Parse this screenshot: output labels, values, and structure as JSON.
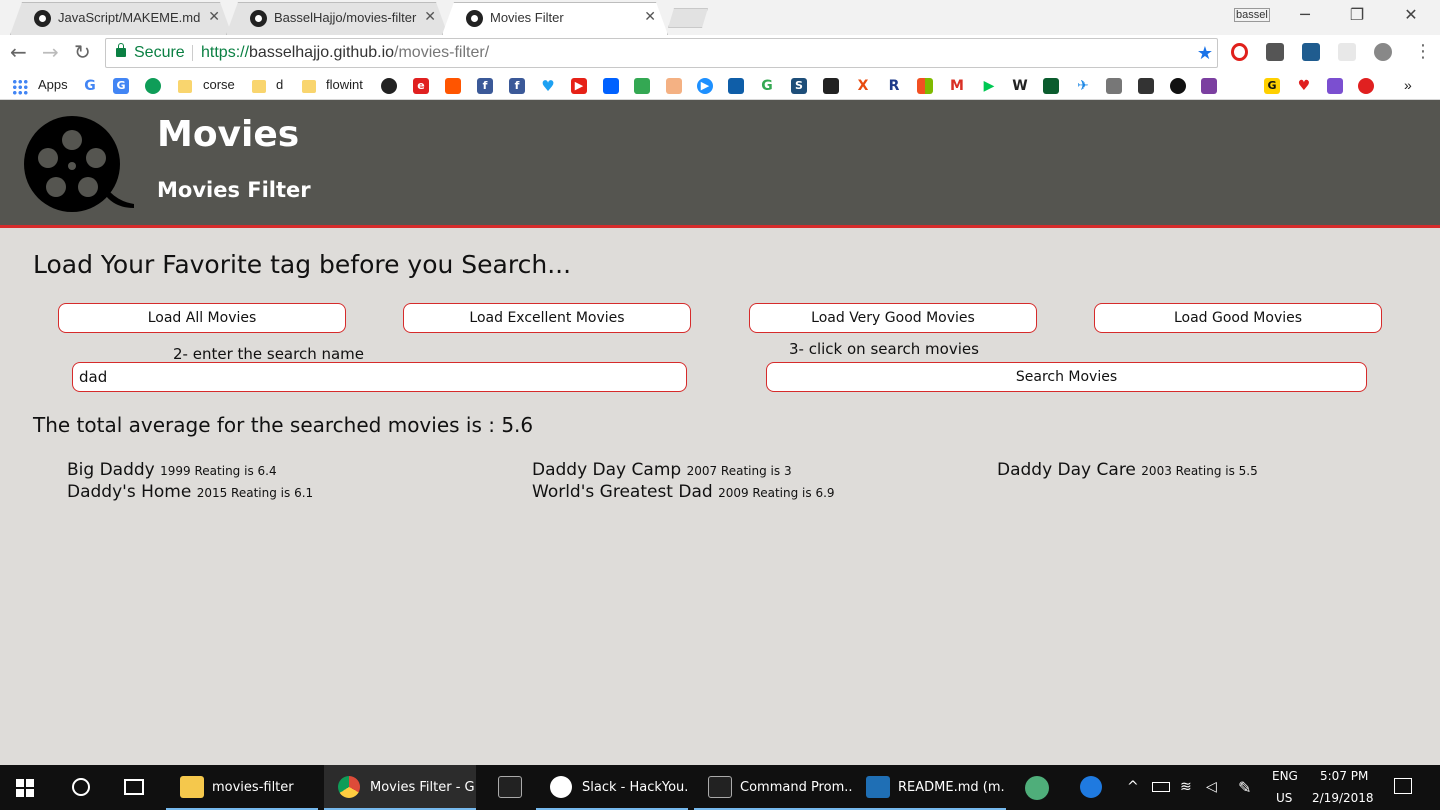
{
  "browser": {
    "tabs": [
      {
        "title": "JavaScript/MAKEME.md",
        "active": false
      },
      {
        "title": "BasselHajjo/movies-filter",
        "active": false
      },
      {
        "title": "Movies Filter",
        "active": true
      }
    ],
    "profile_name": "bassel",
    "security_label": "Secure",
    "url_scheme": "https://",
    "url_host": "basselhajjo.github.io",
    "url_path": "/movies-filter/",
    "bookmarks": {
      "apps_label": "Apps",
      "folder_1": "corse",
      "folder_2": "d",
      "folder_3": "flowint"
    }
  },
  "site": {
    "title": "Movies",
    "subtitle": "Movies Filter"
  },
  "main": {
    "load_heading": "Load Your Favorite tag before you Search...",
    "buttons": {
      "load_all": "Load All Movies",
      "load_excellent": "Load Excellent Movies",
      "load_very_good": "Load Very Good Movies",
      "load_good": "Load Good Movies",
      "search": "Search Movies"
    },
    "hints": {
      "enter_name": "2- enter the search name",
      "click_search": "3- click on search movies"
    },
    "search_value": "dad",
    "average_text": "The total average for the searched movies is : 5.6",
    "movies": [
      {
        "title": "Big Daddy",
        "meta": "1999 Reating is 6.4"
      },
      {
        "title": "Daddy Day Camp",
        "meta": "2007 Reating is 3"
      },
      {
        "title": "Daddy Day Care",
        "meta": "2003 Reating is 5.5"
      },
      {
        "title": "Daddy's Home",
        "meta": "2015 Reating is 6.1"
      },
      {
        "title": "World's Greatest Dad",
        "meta": "2009 Reating is 6.9"
      }
    ]
  },
  "taskbar": {
    "items": [
      {
        "label": "movies-filter",
        "icon": "folder-icon",
        "color": "#f5c84c"
      },
      {
        "label": "Movies Filter - G...",
        "icon": "chrome-icon",
        "color": "#dd4b39"
      },
      {
        "label": "",
        "icon": "terminal-icon",
        "color": "#333333"
      },
      {
        "label": "Slack - HackYou...",
        "icon": "slack-icon",
        "color": "#ffffff"
      },
      {
        "label": "Command Prom...",
        "icon": "cmd-icon",
        "color": "#333333"
      },
      {
        "label": "README.md (m...",
        "icon": "brackets-icon",
        "color": "#1f6fb5"
      }
    ],
    "language_top": "ENG",
    "language_bottom": "US",
    "time": "5:07 PM",
    "date": "2/19/2018"
  },
  "colors": {
    "header_bg": "#555550",
    "accent_red": "#d62b2b",
    "page_bg": "#dedcd9",
    "secure_green": "#0b8043"
  }
}
